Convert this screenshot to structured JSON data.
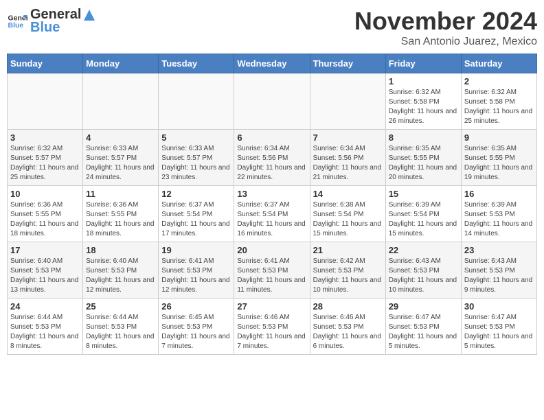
{
  "logo": {
    "text_general": "General",
    "text_blue": "Blue"
  },
  "header": {
    "month_title": "November 2024",
    "subtitle": "San Antonio Juarez, Mexico"
  },
  "days_of_week": [
    "Sunday",
    "Monday",
    "Tuesday",
    "Wednesday",
    "Thursday",
    "Friday",
    "Saturday"
  ],
  "weeks": [
    [
      {
        "day": "",
        "info": ""
      },
      {
        "day": "",
        "info": ""
      },
      {
        "day": "",
        "info": ""
      },
      {
        "day": "",
        "info": ""
      },
      {
        "day": "",
        "info": ""
      },
      {
        "day": "1",
        "info": "Sunrise: 6:32 AM\nSunset: 5:58 PM\nDaylight: 11 hours and 26 minutes."
      },
      {
        "day": "2",
        "info": "Sunrise: 6:32 AM\nSunset: 5:58 PM\nDaylight: 11 hours and 25 minutes."
      }
    ],
    [
      {
        "day": "3",
        "info": "Sunrise: 6:32 AM\nSunset: 5:57 PM\nDaylight: 11 hours and 25 minutes."
      },
      {
        "day": "4",
        "info": "Sunrise: 6:33 AM\nSunset: 5:57 PM\nDaylight: 11 hours and 24 minutes."
      },
      {
        "day": "5",
        "info": "Sunrise: 6:33 AM\nSunset: 5:57 PM\nDaylight: 11 hours and 23 minutes."
      },
      {
        "day": "6",
        "info": "Sunrise: 6:34 AM\nSunset: 5:56 PM\nDaylight: 11 hours and 22 minutes."
      },
      {
        "day": "7",
        "info": "Sunrise: 6:34 AM\nSunset: 5:56 PM\nDaylight: 11 hours and 21 minutes."
      },
      {
        "day": "8",
        "info": "Sunrise: 6:35 AM\nSunset: 5:55 PM\nDaylight: 11 hours and 20 minutes."
      },
      {
        "day": "9",
        "info": "Sunrise: 6:35 AM\nSunset: 5:55 PM\nDaylight: 11 hours and 19 minutes."
      }
    ],
    [
      {
        "day": "10",
        "info": "Sunrise: 6:36 AM\nSunset: 5:55 PM\nDaylight: 11 hours and 18 minutes."
      },
      {
        "day": "11",
        "info": "Sunrise: 6:36 AM\nSunset: 5:55 PM\nDaylight: 11 hours and 18 minutes."
      },
      {
        "day": "12",
        "info": "Sunrise: 6:37 AM\nSunset: 5:54 PM\nDaylight: 11 hours and 17 minutes."
      },
      {
        "day": "13",
        "info": "Sunrise: 6:37 AM\nSunset: 5:54 PM\nDaylight: 11 hours and 16 minutes."
      },
      {
        "day": "14",
        "info": "Sunrise: 6:38 AM\nSunset: 5:54 PM\nDaylight: 11 hours and 15 minutes."
      },
      {
        "day": "15",
        "info": "Sunrise: 6:39 AM\nSunset: 5:54 PM\nDaylight: 11 hours and 15 minutes."
      },
      {
        "day": "16",
        "info": "Sunrise: 6:39 AM\nSunset: 5:53 PM\nDaylight: 11 hours and 14 minutes."
      }
    ],
    [
      {
        "day": "17",
        "info": "Sunrise: 6:40 AM\nSunset: 5:53 PM\nDaylight: 11 hours and 13 minutes."
      },
      {
        "day": "18",
        "info": "Sunrise: 6:40 AM\nSunset: 5:53 PM\nDaylight: 11 hours and 12 minutes."
      },
      {
        "day": "19",
        "info": "Sunrise: 6:41 AM\nSunset: 5:53 PM\nDaylight: 11 hours and 12 minutes."
      },
      {
        "day": "20",
        "info": "Sunrise: 6:41 AM\nSunset: 5:53 PM\nDaylight: 11 hours and 11 minutes."
      },
      {
        "day": "21",
        "info": "Sunrise: 6:42 AM\nSunset: 5:53 PM\nDaylight: 11 hours and 10 minutes."
      },
      {
        "day": "22",
        "info": "Sunrise: 6:43 AM\nSunset: 5:53 PM\nDaylight: 11 hours and 10 minutes."
      },
      {
        "day": "23",
        "info": "Sunrise: 6:43 AM\nSunset: 5:53 PM\nDaylight: 11 hours and 9 minutes."
      }
    ],
    [
      {
        "day": "24",
        "info": "Sunrise: 6:44 AM\nSunset: 5:53 PM\nDaylight: 11 hours and 8 minutes."
      },
      {
        "day": "25",
        "info": "Sunrise: 6:44 AM\nSunset: 5:53 PM\nDaylight: 11 hours and 8 minutes."
      },
      {
        "day": "26",
        "info": "Sunrise: 6:45 AM\nSunset: 5:53 PM\nDaylight: 11 hours and 7 minutes."
      },
      {
        "day": "27",
        "info": "Sunrise: 6:46 AM\nSunset: 5:53 PM\nDaylight: 11 hours and 7 minutes."
      },
      {
        "day": "28",
        "info": "Sunrise: 6:46 AM\nSunset: 5:53 PM\nDaylight: 11 hours and 6 minutes."
      },
      {
        "day": "29",
        "info": "Sunrise: 6:47 AM\nSunset: 5:53 PM\nDaylight: 11 hours and 5 minutes."
      },
      {
        "day": "30",
        "info": "Sunrise: 6:47 AM\nSunset: 5:53 PM\nDaylight: 11 hours and 5 minutes."
      }
    ]
  ]
}
